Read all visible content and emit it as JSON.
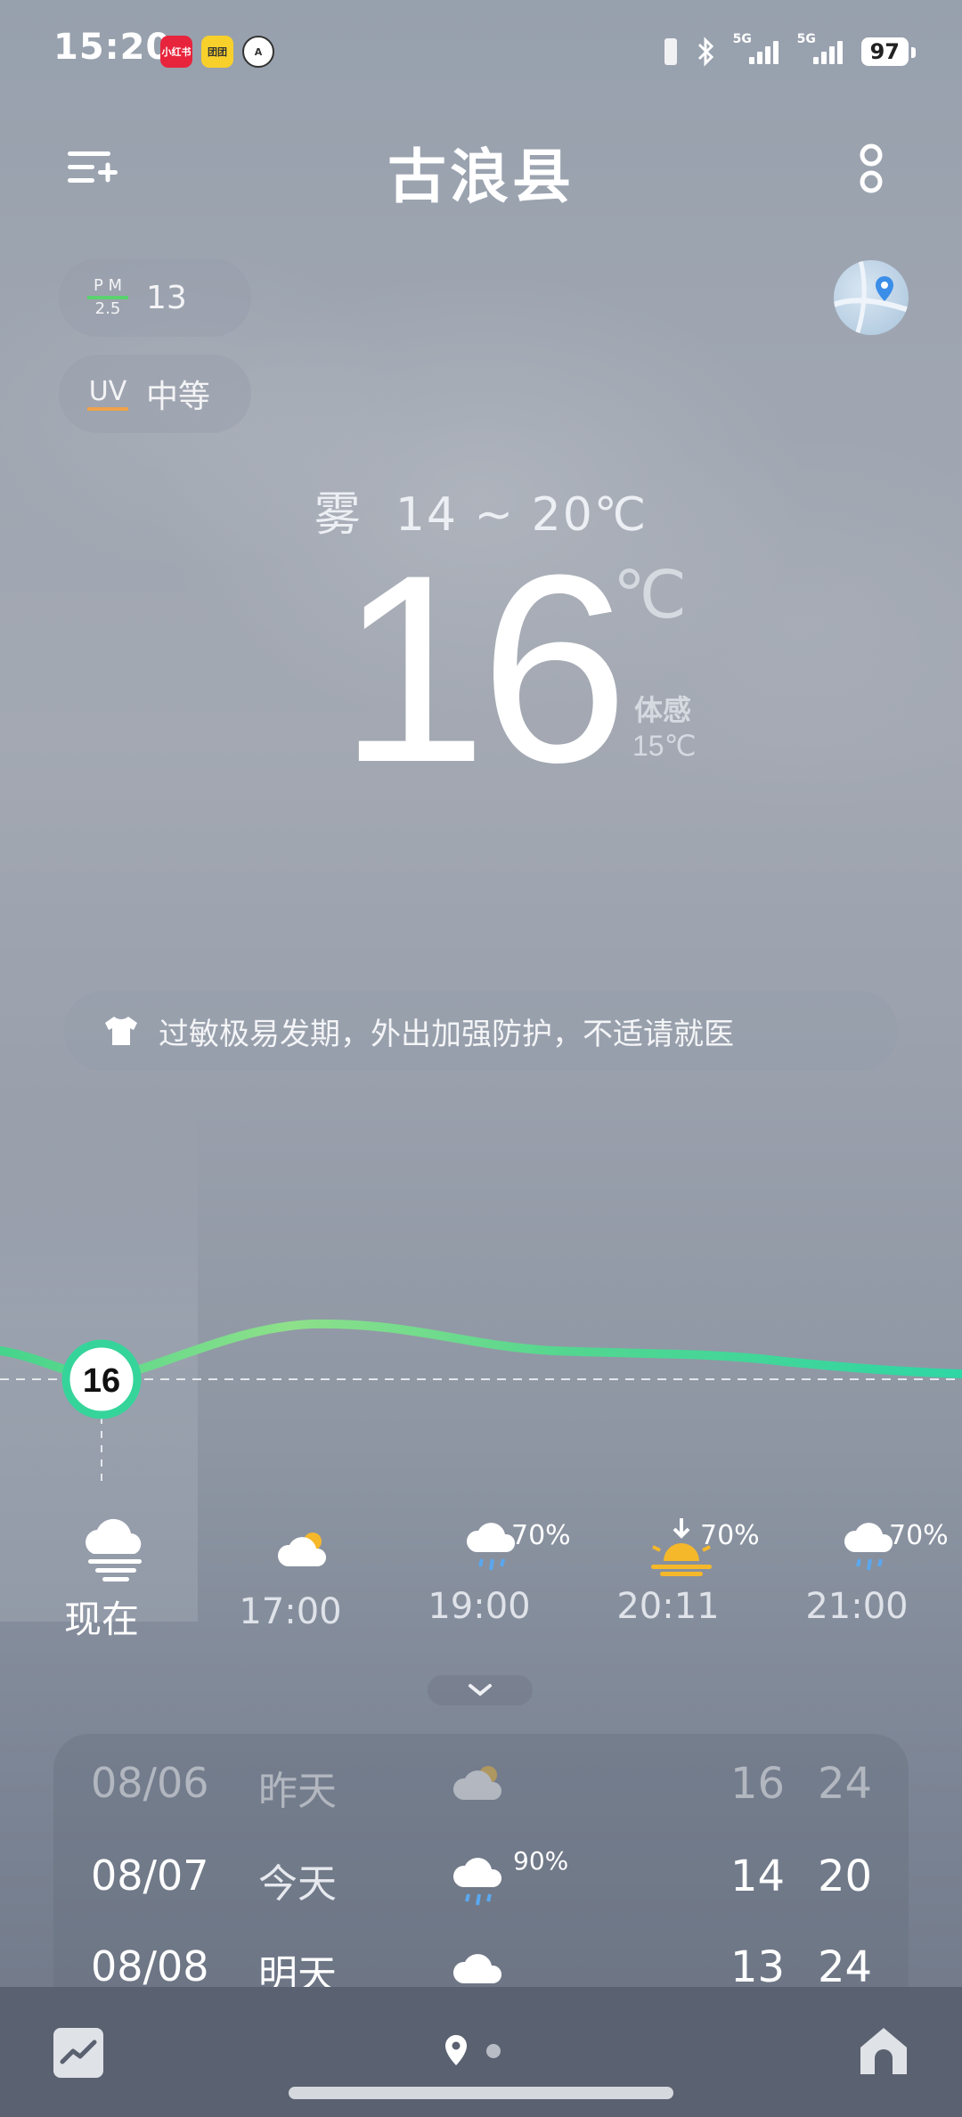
{
  "status_bar": {
    "time": "15:20",
    "apps": [
      "小红书",
      "团团",
      "A"
    ],
    "net1": "5G",
    "net2": "5G",
    "battery": "97"
  },
  "header": {
    "city": "古浪县"
  },
  "aqi": {
    "pm_label_top": "P M",
    "pm_label_bottom": "2.5",
    "pm_value": "13",
    "uv_label": "UV",
    "uv_value": "中等"
  },
  "current": {
    "condition": "雾",
    "range": "14 ~ 20℃",
    "temp": "16",
    "unit": "℃",
    "feels_label": "体感",
    "feels_value": "15℃"
  },
  "tip": {
    "text": "过敏极易发期，外出加强防护，不适请就医",
    "icon": "tshirt-icon"
  },
  "hourly": [
    {
      "time": "现在",
      "icon": "fog-icon",
      "precip": "",
      "temp": 16
    },
    {
      "time": "17:00",
      "icon": "partly-cloudy-icon",
      "precip": "",
      "temp": 18
    },
    {
      "time": "19:00",
      "icon": "rain-icon",
      "precip": "70%",
      "temp": 17
    },
    {
      "time": "20:11",
      "icon": "sunset-icon",
      "precip": "70%",
      "temp": 16.5
    },
    {
      "time": "21:00",
      "icon": "rain-icon",
      "precip": "70%",
      "temp": 16
    }
  ],
  "now_label": "16",
  "daily": [
    {
      "date": "08/06",
      "day": "昨天",
      "icon": "partly-cloudy-icon",
      "precip": "",
      "low": "16",
      "high": "24"
    },
    {
      "date": "08/07",
      "day": "今天",
      "icon": "rain-icon",
      "precip": "90%",
      "low": "14",
      "high": "20"
    },
    {
      "date": "08/08",
      "day": "明天",
      "icon": "cloudy-icon",
      "precip": "",
      "low": "13",
      "high": "24"
    }
  ],
  "colors": {
    "curve": "#48d89a",
    "accent_pm": "#5ad26e",
    "accent_uv": "#f0a24a",
    "sun": "#f5b82a"
  }
}
